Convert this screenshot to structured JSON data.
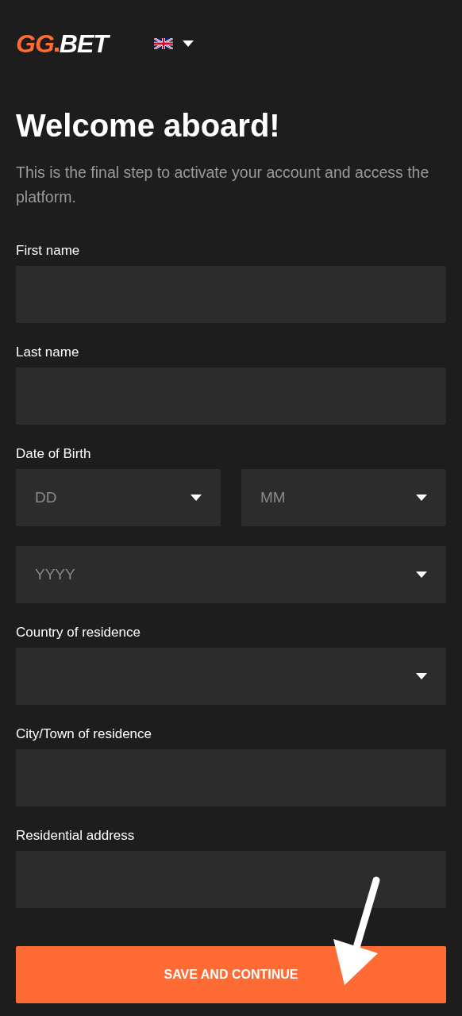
{
  "header": {
    "logo": {
      "accent": "GG",
      "rest": "BET"
    },
    "language_menu": {
      "expanded": false
    }
  },
  "title": "Welcome aboard!",
  "intro": "This is the final step to activate your account and access the platform.",
  "fields": [
    {
      "label": "First name",
      "kind": "text"
    },
    {
      "label": "Last name",
      "kind": "text"
    },
    {
      "label": "Date of Birth",
      "kind": "date",
      "parts": [
        {
          "placeholder": "DD"
        },
        {
          "placeholder": "MM"
        },
        {
          "placeholder": "YYYY"
        }
      ]
    },
    {
      "label": "Country of residence",
      "kind": "select"
    },
    {
      "label": "City/Town of residence",
      "kind": "text"
    },
    {
      "label": "Residential address",
      "kind": "text"
    }
  ],
  "submit": {
    "label": "SAVE AND CONTINUE"
  }
}
